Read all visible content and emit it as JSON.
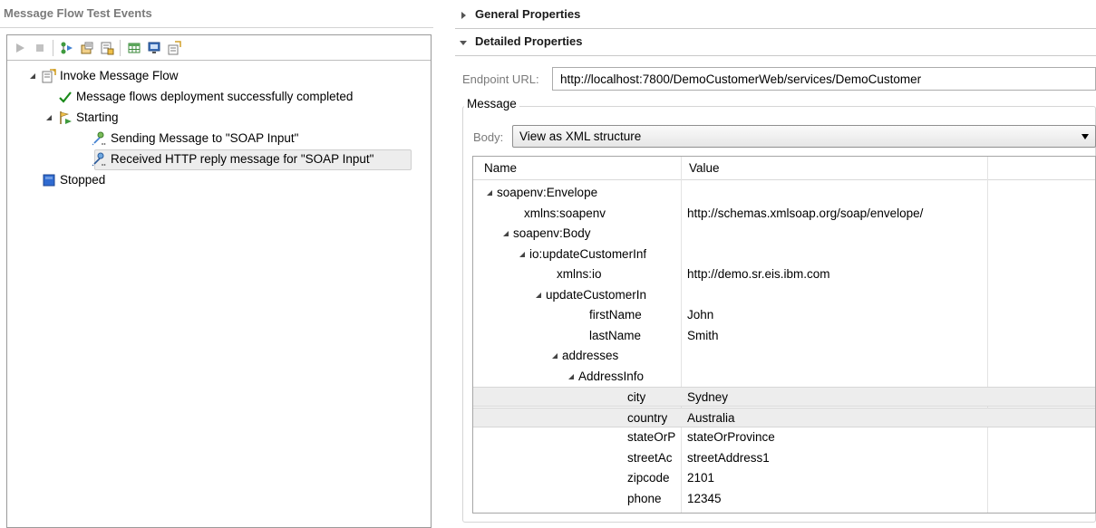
{
  "left": {
    "title": "Message Flow Test Events",
    "toolbar": [
      {
        "name": "run-icon"
      },
      {
        "name": "stop-icon"
      },
      {
        "name": "deploy-icon"
      },
      {
        "name": "save-events-icon"
      },
      {
        "name": "edit-icon"
      },
      {
        "name": "table-icon"
      },
      {
        "name": "monitor-icon"
      },
      {
        "name": "settings-icon"
      }
    ],
    "tree": [
      {
        "label": "Invoke Message Flow",
        "icon": "invoke-flow-icon",
        "expanded": true
      },
      {
        "label": "Message flows deployment successfully completed",
        "icon": "checkmark-icon"
      },
      {
        "label": "Starting",
        "icon": "starting-flag-icon",
        "expanded": true
      },
      {
        "label": "Sending Message to \"SOAP Input\"",
        "icon": "sending-message-icon"
      },
      {
        "label": "Received HTTP reply message for \"SOAP Input\"",
        "icon": "received-message-icon",
        "selected": true
      },
      {
        "label": "Stopped",
        "icon": "stopped-icon"
      }
    ]
  },
  "right": {
    "general_header": "General Properties",
    "detailed_header": "Detailed Properties",
    "endpoint_label": "Endpoint URL:",
    "endpoint_value": "http://localhost:7800/DemoCustomerWeb/services/DemoCustomer",
    "message_legend": "Message",
    "body_label": "Body:",
    "body_value": "View as XML structure",
    "table": {
      "columns": [
        "Name",
        "Value"
      ],
      "rows": [
        {
          "name": "soapenv:Envelope",
          "value": "",
          "expander": true
        },
        {
          "name": "xmlns:soapenv",
          "value": "http://schemas.xmlsoap.org/soap/envelope/"
        },
        {
          "name": "soapenv:Body",
          "value": "",
          "expander": true
        },
        {
          "name": "io:updateCustomerInf",
          "value": "",
          "expander": true
        },
        {
          "name": "xmlns:io",
          "value": "http://demo.sr.eis.ibm.com"
        },
        {
          "name": "updateCustomerIn",
          "value": "",
          "expander": true
        },
        {
          "name": "firstName",
          "value": "John"
        },
        {
          "name": "lastName",
          "value": "Smith"
        },
        {
          "name": "addresses",
          "value": "",
          "expander": true
        },
        {
          "name": "AddressInfo",
          "value": "",
          "expander": true
        },
        {
          "name": "city",
          "value": "Sydney",
          "highlight": true
        },
        {
          "name": "country",
          "value": "Australia",
          "highlight": true
        },
        {
          "name": "stateOrP",
          "value": "stateOrProvince"
        },
        {
          "name": "streetAc",
          "value": "streetAddress1"
        },
        {
          "name": "zipcode",
          "value": "2101"
        },
        {
          "name": "phone",
          "value": "12345"
        }
      ]
    }
  },
  "colors": {
    "checkmark": "#1a8a1a",
    "stopped": "#2f6bd1",
    "selection_bg": "#ededed",
    "label_gray": "#7a7a7a"
  }
}
